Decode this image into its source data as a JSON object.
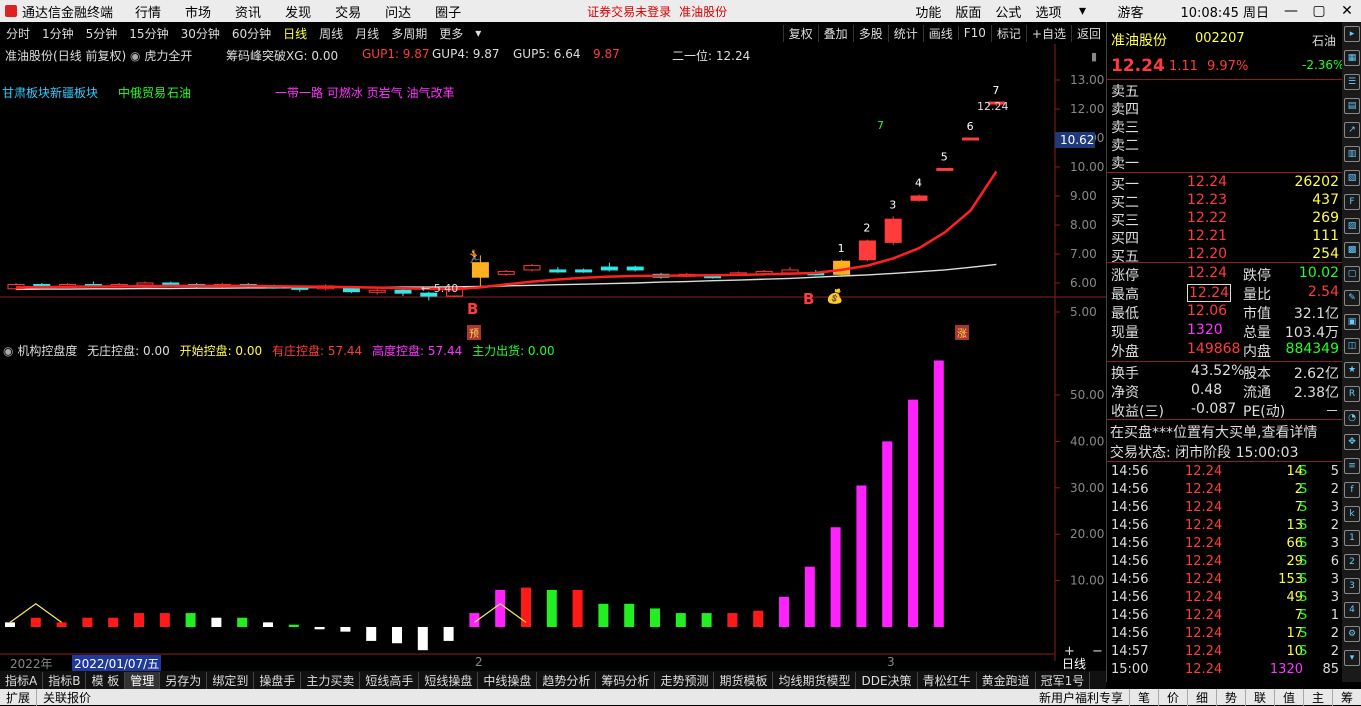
{
  "menubar": {
    "app_title": "通达信金融终端",
    "items": [
      "行情",
      "市场",
      "资讯",
      "发现",
      "交易",
      "问达",
      "圈子"
    ],
    "notice": "证券交易未登录",
    "notice_stock": "准油股份",
    "right_items": [
      "功能",
      "版面",
      "公式",
      "选项"
    ],
    "guest": "游客",
    "time": "10:08:45 周日"
  },
  "toolbar": {
    "timeframes": [
      "分时",
      "1分钟",
      "5分钟",
      "15分钟",
      "30分钟",
      "60分钟",
      "日线",
      "周线",
      "月线",
      "多周期",
      "更多"
    ],
    "active": "日线",
    "right_buttons": [
      "复权",
      "叠加",
      "多股",
      "统计",
      "画线",
      "F10",
      "标记",
      "+自选",
      "返回"
    ]
  },
  "chart": {
    "header_stock": "准油股份",
    "header_mode": "(日线 前复权)",
    "indicator_name": "虎力全开",
    "chip_label": "筹码峰突破XG: 0.00",
    "gup1": "GUP1: 9.87",
    "gup4": "GUP4: 9.87",
    "gup5": "GUP5: 6.64",
    "gup5_val": "9.87",
    "second_label": "二一位: 12.24",
    "tags_left": [
      "甘肃板块",
      "新疆板块"
    ],
    "tags_mid": [
      "中俄贸易",
      "石油"
    ],
    "tags_right": "一带一路 可燃冰 页岩气 油气改革",
    "low_label": "← 5.40",
    "high_label": "12.24",
    "yu_label": "预",
    "zhang_label": "涨",
    "b_label1": "B",
    "b_label2": "B",
    "price_marker": "10.62",
    "price_ticks": [
      "13.00",
      "12.00",
      "11.00",
      "10.00",
      "9.00",
      "8.00",
      "7.00",
      "6.00",
      "5.00"
    ],
    "counts": [
      "1",
      "2",
      "3",
      "4",
      "5",
      "6",
      "7",
      "7"
    ],
    "indicator_header": "机构控盘度",
    "ind_vals": {
      "none": "无庄控盘: 0.00",
      "start": "开始控盘: 0.00",
      "has": "有庄控盘: 57.44",
      "high": "高度控盘: 57.44",
      "out": "主力出货: 0.00"
    },
    "ind_ticks": [
      "50.00",
      "40.00",
      "30.00",
      "20.00",
      "10.00"
    ],
    "x_year": "2022年",
    "x_date": "2022/01/07/五",
    "x_ticks": [
      "2",
      "3"
    ],
    "period_button": "日线"
  },
  "bottom_tabs": [
    "指标A",
    "指标B",
    "模 板",
    "管理",
    "另存为",
    "绑定到",
    "操盘手",
    "主力买卖",
    "短线高手",
    "短线操盘",
    "中线操盘",
    "趋势分析",
    "筹码分析",
    "走势预测",
    "期货模板",
    "均线期货模型",
    "DDE决策",
    "青松红牛",
    "黄金跑道",
    "冠军1号"
  ],
  "status": {
    "left": [
      "扩展",
      "关联报价"
    ],
    "right": "新用户福利专享",
    "right_tabs": [
      "笔",
      "价",
      "细",
      "势",
      "联",
      "值",
      "主",
      "筹"
    ]
  },
  "quote": {
    "name": "准油股份",
    "code": "002207",
    "sector": "石油",
    "sector_pct": "-2.36%",
    "price": "12.24",
    "change": "1.11",
    "pct": "9.97%",
    "sell": [
      {
        "label": "卖五"
      },
      {
        "label": "卖四"
      },
      {
        "label": "卖三"
      },
      {
        "label": "卖二"
      },
      {
        "label": "卖一"
      }
    ],
    "buy": [
      {
        "label": "买一",
        "price": "12.24",
        "vol": "26202"
      },
      {
        "label": "买二",
        "price": "12.23",
        "vol": "437"
      },
      {
        "label": "买三",
        "price": "12.22",
        "vol": "269"
      },
      {
        "label": "买四",
        "price": "12.21",
        "vol": "111"
      },
      {
        "label": "买五",
        "price": "12.20",
        "vol": "254"
      }
    ],
    "stats": [
      {
        "l1": "涨停",
        "v1": "12.24",
        "l2": "跌停",
        "v2": "10.02"
      },
      {
        "l1": "最高",
        "v1": "12.24",
        "l2": "量比",
        "v2": "2.54"
      },
      {
        "l1": "最低",
        "v1": "12.06",
        "l2": "市值",
        "v2": "32.1亿"
      },
      {
        "l1": "现量",
        "v1": "1320",
        "l2": "总量",
        "v2": "103.4万"
      },
      {
        "l1": "外盘",
        "v1": "149868",
        "l2": "内盘",
        "v2": "884349"
      }
    ],
    "stats2": [
      {
        "l1": "换手",
        "v1": "43.52%",
        "l2": "股本",
        "v2": "2.62亿"
      },
      {
        "l1": "净资",
        "v1": "0.48",
        "l2": "流通",
        "v2": "2.38亿"
      },
      {
        "l1": "收益(三)",
        "v1": "-0.087",
        "l2": "PE(动)",
        "v2": "－"
      }
    ],
    "notice": "在买盘***位置有大买单,查看详情",
    "trade_state": "交易状态: 闭市阶段 15:00:03",
    "ticks": [
      {
        "t": "14:56",
        "p": "12.24",
        "v": "14",
        "s": "S",
        "n": "5"
      },
      {
        "t": "14:56",
        "p": "12.24",
        "v": "2",
        "s": "S",
        "n": "2"
      },
      {
        "t": "14:56",
        "p": "12.24",
        "v": "7",
        "s": "S",
        "n": "3"
      },
      {
        "t": "14:56",
        "p": "12.24",
        "v": "13",
        "s": "S",
        "n": "2"
      },
      {
        "t": "14:56",
        "p": "12.24",
        "v": "66",
        "s": "S",
        "n": "3"
      },
      {
        "t": "14:56",
        "p": "12.24",
        "v": "29",
        "s": "S",
        "n": "6"
      },
      {
        "t": "14:56",
        "p": "12.24",
        "v": "153",
        "s": "S",
        "n": "3"
      },
      {
        "t": "14:56",
        "p": "12.24",
        "v": "49",
        "s": "S",
        "n": "3"
      },
      {
        "t": "14:56",
        "p": "12.24",
        "v": "7",
        "s": "S",
        "n": "1"
      },
      {
        "t": "14:56",
        "p": "12.24",
        "v": "17",
        "s": "S",
        "n": "2"
      },
      {
        "t": "14:57",
        "p": "12.24",
        "v": "10",
        "s": "S",
        "n": "2"
      },
      {
        "t": "15:00",
        "p": "12.24",
        "v": "1320",
        "s": "",
        "n": "85"
      }
    ]
  },
  "chart_data": [
    {
      "type": "candlestick",
      "ylim": [
        4.3,
        13.3
      ],
      "ticks": [
        5,
        6,
        7,
        8,
        9,
        10,
        11,
        12,
        13
      ],
      "candles": [
        {
          "o": 5.8,
          "c": 5.95,
          "h": 6.0,
          "l": 5.75
        },
        {
          "o": 5.95,
          "c": 5.85,
          "h": 6.0,
          "l": 5.8
        },
        {
          "o": 5.85,
          "c": 5.95,
          "h": 6.0,
          "l": 5.8
        },
        {
          "o": 5.95,
          "c": 5.9,
          "h": 6.05,
          "l": 5.85
        },
        {
          "o": 5.9,
          "c": 5.95,
          "h": 6.0,
          "l": 5.85
        },
        {
          "o": 5.95,
          "c": 6.0,
          "h": 6.05,
          "l": 5.9
        },
        {
          "o": 6.0,
          "c": 5.95,
          "h": 6.05,
          "l": 5.9
        },
        {
          "o": 5.95,
          "c": 5.9,
          "h": 6.0,
          "l": 5.85
        },
        {
          "o": 5.9,
          "c": 5.95,
          "h": 6.0,
          "l": 5.85
        },
        {
          "o": 5.95,
          "c": 5.9,
          "h": 6.0,
          "l": 5.85
        },
        {
          "o": 5.9,
          "c": 5.85,
          "h": 5.95,
          "l": 5.8
        },
        {
          "o": 5.85,
          "c": 5.8,
          "h": 5.9,
          "l": 5.7
        },
        {
          "o": 5.8,
          "c": 5.9,
          "h": 5.95,
          "l": 5.75
        },
        {
          "o": 5.85,
          "c": 5.7,
          "h": 5.9,
          "l": 5.65
        },
        {
          "o": 5.7,
          "c": 5.75,
          "h": 5.8,
          "l": 5.6
        },
        {
          "o": 5.75,
          "c": 5.65,
          "h": 5.8,
          "l": 5.55
        },
        {
          "o": 5.65,
          "c": 5.55,
          "h": 5.7,
          "l": 5.4
        },
        {
          "o": 5.55,
          "c": 5.85,
          "h": 5.9,
          "l": 5.5
        },
        {
          "o": 6.2,
          "c": 6.7,
          "h": 6.95,
          "l": 5.9
        },
        {
          "o": 6.3,
          "c": 6.4,
          "h": 6.45,
          "l": 6.25
        },
        {
          "o": 6.45,
          "c": 6.6,
          "h": 6.65,
          "l": 6.4
        },
        {
          "o": 6.45,
          "c": 6.4,
          "h": 6.55,
          "l": 6.35
        },
        {
          "o": 6.45,
          "c": 6.4,
          "h": 6.5,
          "l": 6.35
        },
        {
          "o": 6.55,
          "c": 6.45,
          "h": 6.7,
          "l": 6.4
        },
        {
          "o": 6.55,
          "c": 6.45,
          "h": 6.6,
          "l": 6.4
        },
        {
          "o": 6.3,
          "c": 6.2,
          "h": 6.35,
          "l": 6.15
        },
        {
          "o": 6.25,
          "c": 6.3,
          "h": 6.35,
          "l": 6.2
        },
        {
          "o": 6.25,
          "c": 6.2,
          "h": 6.3,
          "l": 6.15
        },
        {
          "o": 6.3,
          "c": 6.35,
          "h": 6.4,
          "l": 6.25
        },
        {
          "o": 6.3,
          "c": 6.4,
          "h": 6.45,
          "l": 6.25
        },
        {
          "o": 6.35,
          "c": 6.45,
          "h": 6.55,
          "l": 6.3
        },
        {
          "o": 6.35,
          "c": 6.3,
          "h": 6.45,
          "l": 6.25
        },
        {
          "o": 6.3,
          "c": 6.75,
          "h": 6.8,
          "l": 6.25
        },
        {
          "o": 6.8,
          "c": 7.45,
          "h": 7.5,
          "l": 6.75
        },
        {
          "o": 7.4,
          "c": 8.2,
          "h": 8.3,
          "l": 7.3
        },
        {
          "o": 8.85,
          "c": 9.0,
          "h": 9.05,
          "l": 8.8
        },
        {
          "o": 9.9,
          "c": 9.95,
          "h": 9.95,
          "l": 9.9
        },
        {
          "o": 10.95,
          "c": 11.0,
          "h": 11.0,
          "l": 10.95
        },
        {
          "o": 12.24,
          "c": 12.24,
          "h": 12.24,
          "l": 12.1
        }
      ],
      "ma_red": [
        5.85,
        5.86,
        5.87,
        5.88,
        5.88,
        5.89,
        5.9,
        5.9,
        5.9,
        5.9,
        5.89,
        5.88,
        5.87,
        5.86,
        5.84,
        5.82,
        5.8,
        5.78,
        5.85,
        5.95,
        6.05,
        6.12,
        6.18,
        6.22,
        6.24,
        6.25,
        6.26,
        6.27,
        6.28,
        6.3,
        6.32,
        6.35,
        6.45,
        6.6,
        6.85,
        7.2,
        7.75,
        8.5,
        9.85
      ],
      "ma_white": [
        5.78,
        5.79,
        5.79,
        5.8,
        5.8,
        5.81,
        5.81,
        5.82,
        5.82,
        5.83,
        5.83,
        5.84,
        5.84,
        5.85,
        5.85,
        5.86,
        5.86,
        5.87,
        5.88,
        5.9,
        5.92,
        5.94,
        5.96,
        5.98,
        6.0,
        6.03,
        6.05,
        6.08,
        6.1,
        6.13,
        6.16,
        6.2,
        6.24,
        6.28,
        6.33,
        6.39,
        6.45,
        6.54,
        6.64
      ]
    },
    {
      "type": "bar",
      "title": "机构控盘度",
      "ylim": [
        -6,
        60
      ],
      "ticks": [
        10,
        20,
        30,
        40,
        50
      ],
      "values": [
        1,
        2,
        1,
        2,
        2,
        3,
        3,
        3,
        2,
        2,
        1,
        0.5,
        -0.5,
        -1,
        -3,
        -3.5,
        -5,
        -3,
        3,
        8,
        8.5,
        8,
        8,
        5,
        5,
        4,
        3,
        3,
        3,
        3.5,
        6.5,
        13,
        21.5,
        30.5,
        40,
        49,
        57.44
      ],
      "colors": [
        "w",
        "r",
        "r",
        "r",
        "r",
        "r",
        "r",
        "g",
        "w",
        "g",
        "w",
        "g",
        "w",
        "w",
        "w",
        "w",
        "w",
        "w",
        "m",
        "m",
        "r",
        "g",
        "r",
        "g",
        "g",
        "g",
        "g",
        "g",
        "r",
        "r",
        "m",
        "m",
        "m",
        "m",
        "m",
        "m",
        "m"
      ],
      "yellow_line": [
        [
          0,
          1
        ],
        [
          1,
          5
        ],
        [
          2,
          1
        ],
        [
          18,
          1
        ],
        [
          19,
          5
        ],
        [
          20,
          1
        ]
      ]
    }
  ]
}
